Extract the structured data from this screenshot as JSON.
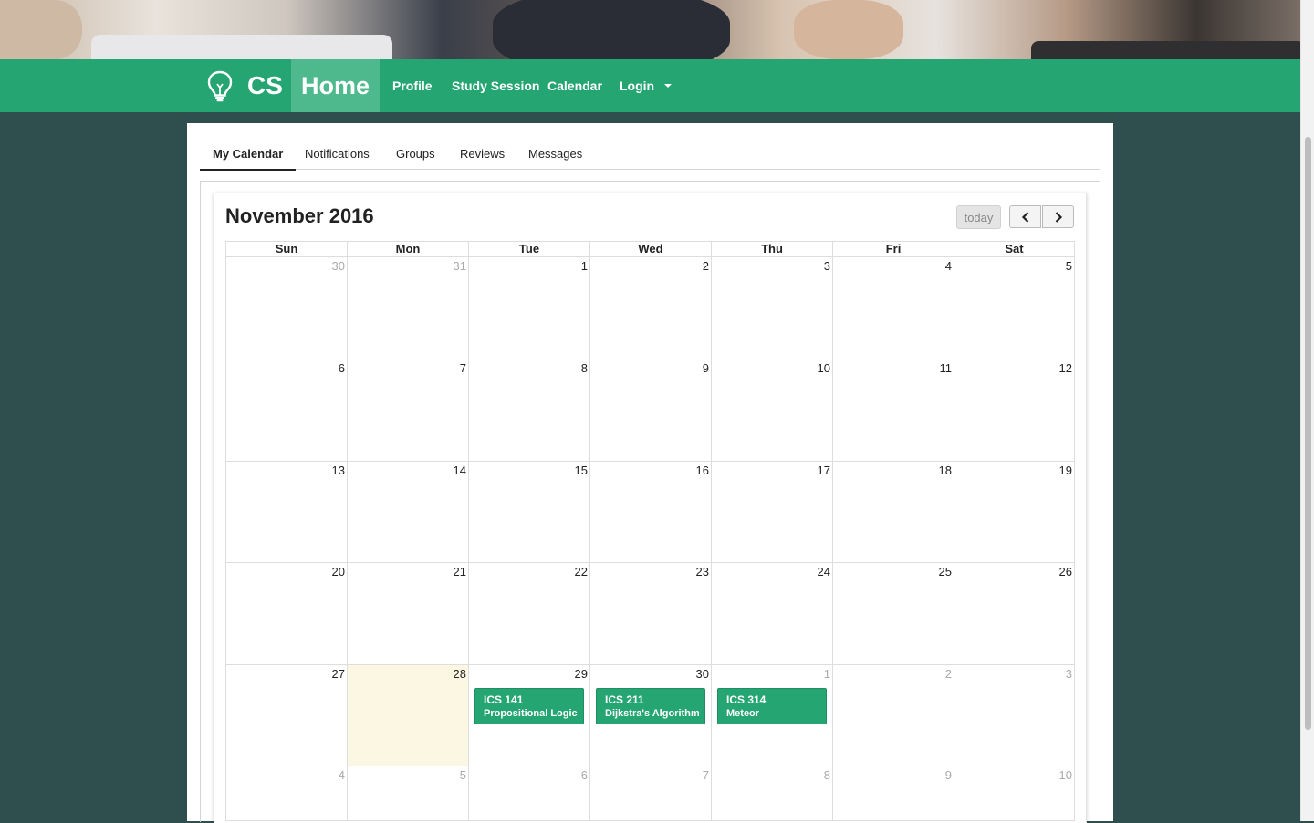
{
  "brand": {
    "text": "CS"
  },
  "nav": {
    "home": "Home",
    "profile": "Profile",
    "study_session": "Study Session",
    "calendar": "Calendar",
    "login": "Login"
  },
  "tabs": [
    "My Calendar",
    "Notifications",
    "Groups",
    "Reviews",
    "Messages"
  ],
  "calendar": {
    "title": "November 2016",
    "today_button": "today",
    "days_of_week": [
      "Sun",
      "Mon",
      "Tue",
      "Wed",
      "Thu",
      "Fri",
      "Sat"
    ],
    "weeks": [
      [
        {
          "n": "30",
          "o": true
        },
        {
          "n": "31",
          "o": true
        },
        {
          "n": "1"
        },
        {
          "n": "2"
        },
        {
          "n": "3"
        },
        {
          "n": "4"
        },
        {
          "n": "5"
        }
      ],
      [
        {
          "n": "6"
        },
        {
          "n": "7"
        },
        {
          "n": "8"
        },
        {
          "n": "9"
        },
        {
          "n": "10"
        },
        {
          "n": "11"
        },
        {
          "n": "12"
        }
      ],
      [
        {
          "n": "13"
        },
        {
          "n": "14"
        },
        {
          "n": "15"
        },
        {
          "n": "16"
        },
        {
          "n": "17"
        },
        {
          "n": "18"
        },
        {
          "n": "19"
        }
      ],
      [
        {
          "n": "20"
        },
        {
          "n": "21"
        },
        {
          "n": "22"
        },
        {
          "n": "23"
        },
        {
          "n": "24"
        },
        {
          "n": "25"
        },
        {
          "n": "26"
        }
      ],
      [
        {
          "n": "27"
        },
        {
          "n": "28",
          "today": true
        },
        {
          "n": "29"
        },
        {
          "n": "30"
        },
        {
          "n": "1",
          "o": true
        },
        {
          "n": "2",
          "o": true
        },
        {
          "n": "3",
          "o": true
        }
      ],
      [
        {
          "n": "4",
          "o": true
        },
        {
          "n": "5",
          "o": true
        },
        {
          "n": "6",
          "o": true
        },
        {
          "n": "7",
          "o": true
        },
        {
          "n": "8",
          "o": true
        },
        {
          "n": "9",
          "o": true
        },
        {
          "n": "10",
          "o": true
        }
      ]
    ],
    "events": [
      {
        "week": 4,
        "day": 2,
        "title": "ICS 141",
        "subtitle": "Propositional Logic"
      },
      {
        "week": 4,
        "day": 3,
        "title": "ICS 211",
        "subtitle": "Dijkstra's Algorithm"
      },
      {
        "week": 4,
        "day": 4,
        "title": "ICS 314",
        "subtitle": "Meteor"
      }
    ]
  },
  "colors": {
    "primary": "#25a571",
    "background": "#2e4f4e",
    "today_highlight": "#fcf7e3"
  }
}
